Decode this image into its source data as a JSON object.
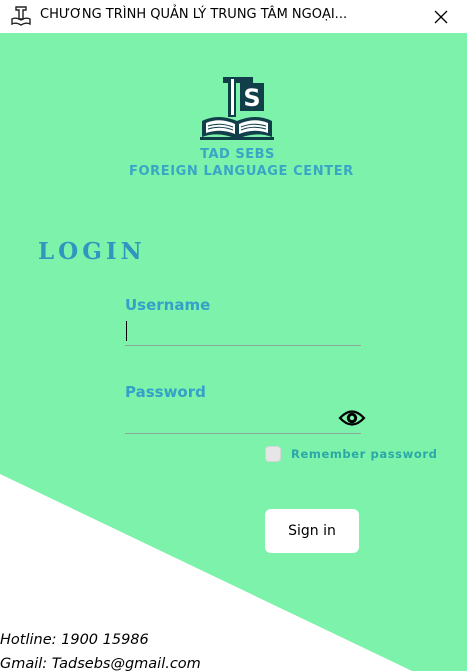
{
  "window": {
    "title": "CHƯƠNG TRÌNH QUẢN LÝ TRUNG TÂM NGOẠI...",
    "close_icon": "close-icon",
    "app_icon": "ts-logo-icon"
  },
  "brand": {
    "logo": "ts-book-logo",
    "name": "TAD SEBS",
    "tagline": "FOREIGN LANGUAGE CENTER"
  },
  "login": {
    "title": "LOGIN",
    "username_label": "Username",
    "username_value": "",
    "password_label": "Password",
    "password_value": "",
    "show_password_icon": "eye-icon",
    "remember_label": "Remember password",
    "remember_checked": false,
    "signin_label": "Sign in"
  },
  "footer": {
    "hotline": "Hotline: 1900 15986",
    "gmail": "Gmail: Tadsebs@gmail.com"
  },
  "colors": {
    "background_green": "#7df2aa",
    "accent_blue": "#35a0c8",
    "logo_dark": "#103f4a",
    "remember_teal": "#2aa8a8"
  }
}
